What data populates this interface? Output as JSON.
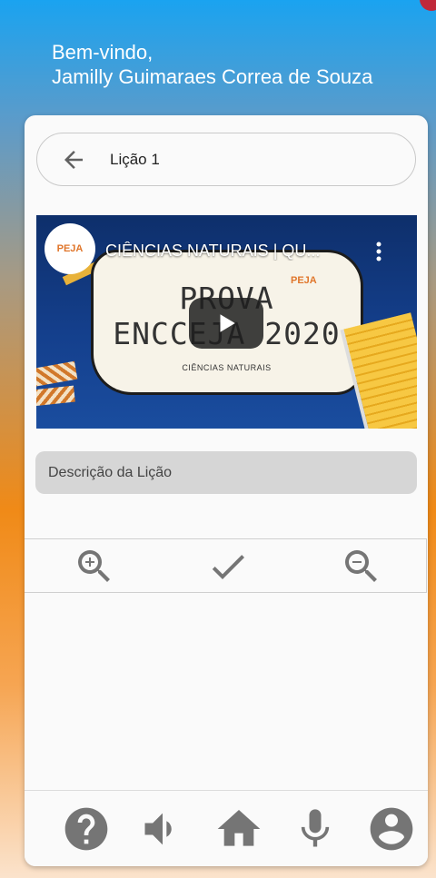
{
  "header": {
    "greeting": "Bem-vindo,",
    "user_name": "Jamilly Guimaraes Correa de Souza"
  },
  "lesson": {
    "title": "Lição 1",
    "back_icon": "arrow-back-icon"
  },
  "video": {
    "title": "CIÊNCIAS NATURAIS | QU...",
    "channel_logo_text": "PEJA",
    "thumbnail_line1": "PROVA",
    "thumbnail_line2": "ENCCEJA 2020",
    "thumbnail_subject": "CIÊNCIAS NATURAIS",
    "side_logo_text": "PEJA",
    "icons": [
      "play-icon",
      "more-vert-icon"
    ]
  },
  "description": {
    "placeholder": "Descrição da Lição"
  },
  "toolbar": {
    "items": [
      "zoom-in-icon",
      "check-icon",
      "zoom-out-icon"
    ]
  },
  "bottom_nav": {
    "items": [
      "help-icon",
      "volume-icon",
      "home-icon",
      "mic-icon",
      "account-icon"
    ]
  },
  "colors": {
    "icon": "#757575",
    "card_bg": "#fafafa",
    "field_bg": "#d6d6d6",
    "gradient_top": "#1aa3f0",
    "gradient_mid": "#f08a17"
  }
}
